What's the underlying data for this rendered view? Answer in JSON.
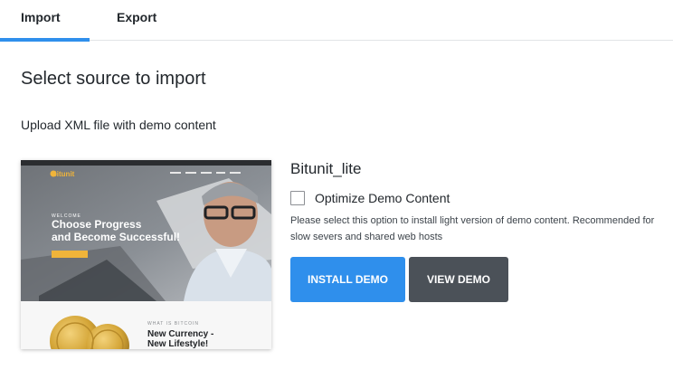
{
  "tabs": [
    {
      "label": "Import",
      "active": true
    },
    {
      "label": "Export",
      "active": false
    }
  ],
  "main": {
    "heading": "Select source to import",
    "subheading": "Upload XML file with demo content"
  },
  "preview": {
    "logo": "Bitunit",
    "welcome": "WELCOME",
    "headline_1": "Choose Progress",
    "headline_2": "and Become Successful!",
    "section_label": "WHAT IS BITCOIN",
    "section_title_1": "New Currency -",
    "section_title_2": "New Lifestyle!"
  },
  "demo": {
    "title": "Bitunit_lite",
    "option_label": "Optimize Demo Content",
    "option_checked": false,
    "option_description": "Please select this option to install light version of demo content. Recommended for slow severs and shared web hosts",
    "install_label": "INSTALL DEMO",
    "view_label": "VIEW DEMO"
  },
  "colors": {
    "accent": "#2f8fec",
    "dark_button": "#4b5158"
  }
}
